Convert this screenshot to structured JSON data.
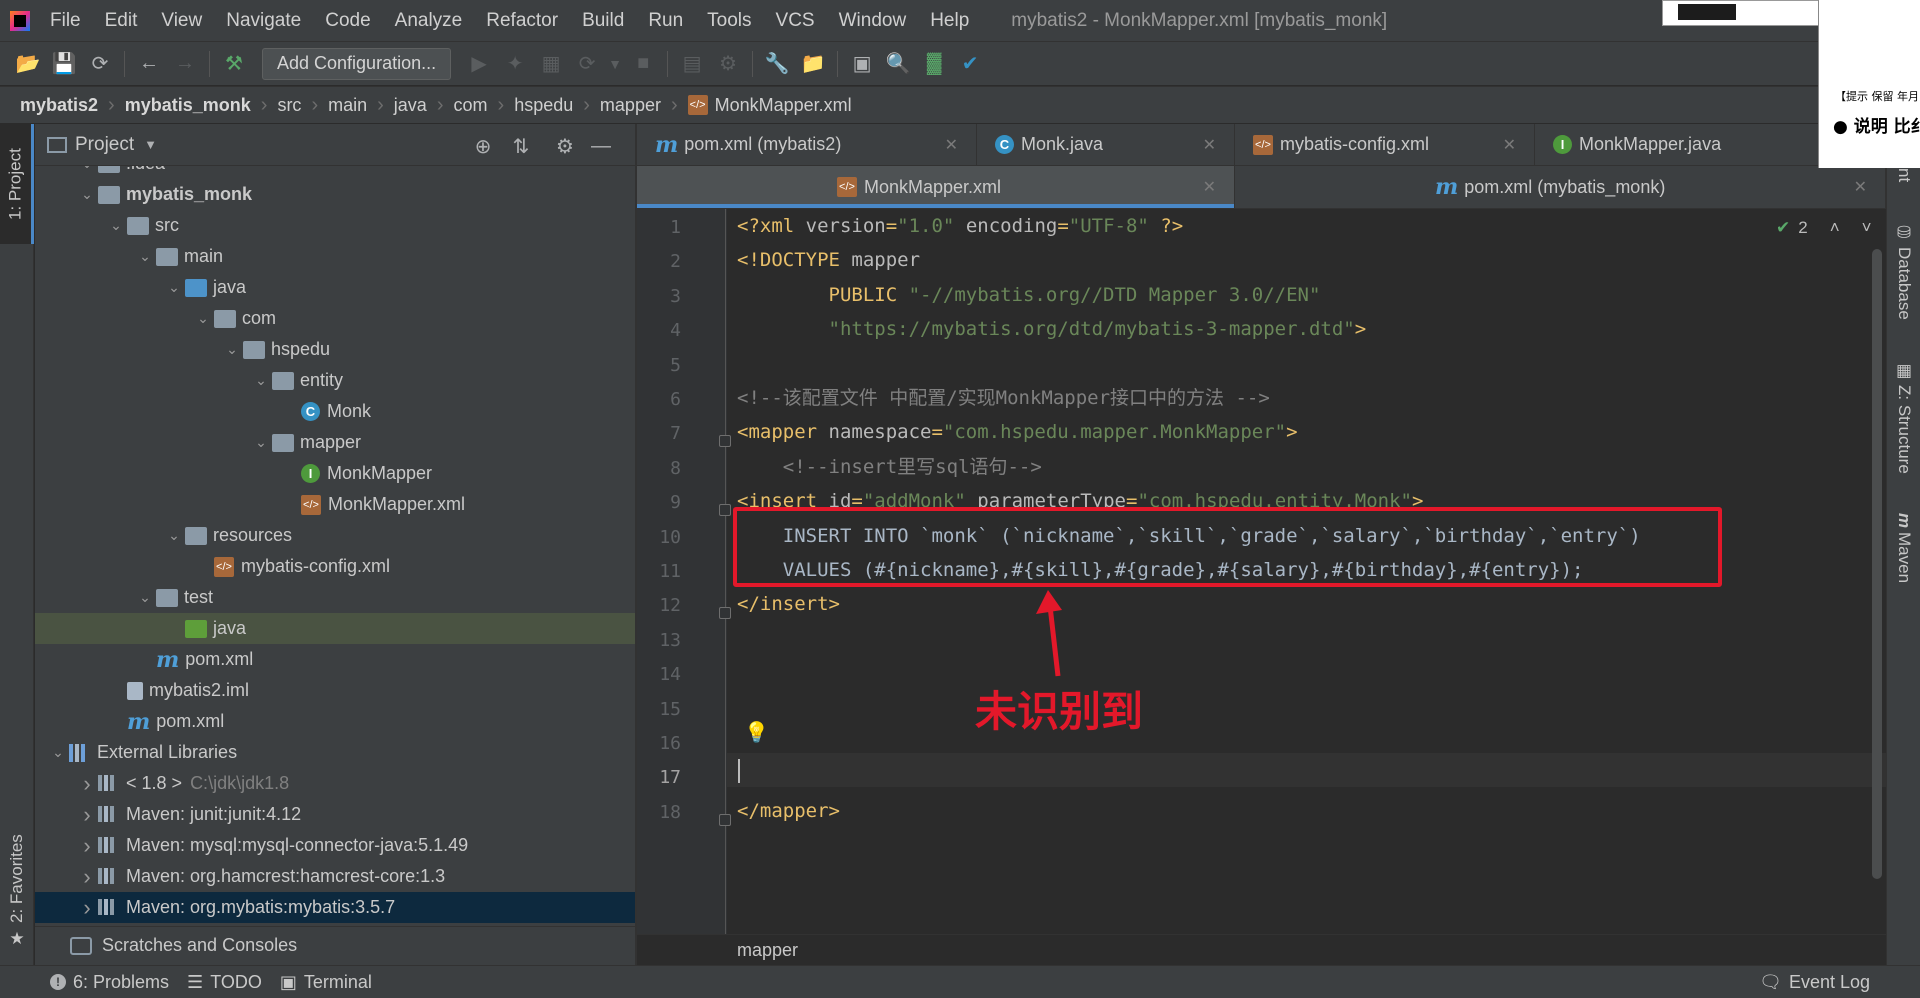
{
  "menubar": {
    "items": [
      "File",
      "Edit",
      "View",
      "Navigate",
      "Code",
      "Analyze",
      "Refactor",
      "Build",
      "Run",
      "Tools",
      "VCS",
      "Window",
      "Help"
    ],
    "window_title": "mybatis2 - MonkMapper.xml [mybatis_monk]"
  },
  "toolbar": {
    "add_configuration": "Add Configuration..."
  },
  "breadcrumbs": [
    "mybatis2",
    "mybatis_monk",
    "src",
    "main",
    "java",
    "com",
    "hspedu",
    "mapper",
    "MonkMapper.xml"
  ],
  "left_strip": {
    "project_tab": "1: Project",
    "favorites_tab": "2: Favorites"
  },
  "right_strip": {
    "database_tab": "Database",
    "structure_tab": "Z: Structure",
    "maven_tab": "Maven",
    "ant_tab": "nt"
  },
  "project": {
    "header": "Project",
    "tree": [
      {
        "label": ".idea",
        "type": "folder"
      },
      {
        "label": "mybatis_monk",
        "type": "module"
      },
      {
        "label": "src",
        "type": "folder"
      },
      {
        "label": "main",
        "type": "folder"
      },
      {
        "label": "java",
        "type": "folder-blue"
      },
      {
        "label": "com",
        "type": "package"
      },
      {
        "label": "hspedu",
        "type": "package"
      },
      {
        "label": "entity",
        "type": "package"
      },
      {
        "label": "Monk",
        "type": "class"
      },
      {
        "label": "mapper",
        "type": "package"
      },
      {
        "label": "MonkMapper",
        "type": "interface"
      },
      {
        "label": "MonkMapper.xml",
        "type": "xml"
      },
      {
        "label": "resources",
        "type": "folder-res"
      },
      {
        "label": "mybatis-config.xml",
        "type": "xml"
      },
      {
        "label": "test",
        "type": "folder"
      },
      {
        "label": "java",
        "type": "folder-green"
      },
      {
        "label": "pom.xml",
        "type": "maven"
      },
      {
        "label": "mybatis2.iml",
        "type": "iml"
      },
      {
        "label": "pom.xml",
        "type": "maven"
      },
      {
        "label": "External Libraries",
        "type": "libs"
      },
      {
        "label": "< 1.8 >",
        "extra": "C:\\jdk\\jdk1.8",
        "type": "jdk"
      },
      {
        "label": "Maven: junit:junit:4.12",
        "type": "lib"
      },
      {
        "label": "Maven: mysql:mysql-connector-java:5.1.49",
        "type": "lib"
      },
      {
        "label": "Maven: org.hamcrest:hamcrest-core:1.3",
        "type": "lib"
      },
      {
        "label": "Maven: org.mybatis:mybatis:3.5.7",
        "type": "lib"
      }
    ],
    "scratches": "Scratches and Consoles"
  },
  "tabs_row1": [
    {
      "label": "pom.xml (mybatis2)",
      "icon": "maven-icon"
    },
    {
      "label": "Monk.java",
      "icon": "class-icon"
    },
    {
      "label": "mybatis-config.xml",
      "icon": "xml-icon"
    },
    {
      "label": "MonkMapper.java",
      "icon": "interface-icon"
    }
  ],
  "tabs_row2": [
    {
      "label": "MonkMapper.xml",
      "icon": "xml-icon",
      "active": true
    },
    {
      "label": "pom.xml (mybatis_monk)",
      "icon": "maven-icon"
    }
  ],
  "editor": {
    "line_numbers": [
      "1",
      "2",
      "3",
      "4",
      "5",
      "6",
      "7",
      "8",
      "9",
      "10",
      "11",
      "12",
      "13",
      "14",
      "15",
      "16",
      "17",
      "18"
    ],
    "lines": [
      {
        "seg": [
          [
            "t-tag",
            "<?xml "
          ],
          [
            "t-attr",
            "version"
          ],
          [
            "t-tag",
            "="
          ],
          [
            "t-val",
            "\"1.0\""
          ],
          [
            "t-tag",
            " "
          ],
          [
            "t-attr",
            "encoding"
          ],
          [
            "t-tag",
            "="
          ],
          [
            "t-val",
            "\"UTF-8\""
          ],
          [
            "t-tag",
            " ?>"
          ]
        ]
      },
      {
        "seg": [
          [
            "t-tag",
            "<!DOCTYPE "
          ],
          [
            "t-attr",
            "mapper"
          ]
        ]
      },
      {
        "seg": [
          [
            "t-tag",
            "        PUBLIC "
          ],
          [
            "t-val",
            "\"-//mybatis.org//DTD Mapper 3.0//EN\""
          ]
        ]
      },
      {
        "seg": [
          [
            "t-val",
            "        \"https://mybatis.org/dtd/mybatis-3-mapper.dtd\""
          ],
          [
            "t-tag",
            ">"
          ]
        ]
      },
      {
        "seg": []
      },
      {
        "seg": [
          [
            "t-com",
            "<!--该配置文件 中配置/实现MonkMapper接口中的方法 -->"
          ]
        ]
      },
      {
        "seg": [
          [
            "t-tag",
            "<mapper "
          ],
          [
            "t-attr",
            "namespace"
          ],
          [
            "t-tag",
            "="
          ],
          [
            "t-val",
            "\"com.hspedu.mapper.MonkMapper\""
          ],
          [
            "t-tag",
            ">"
          ]
        ]
      },
      {
        "seg": [
          [
            "t-com",
            "    <!--insert里写sql语句-->"
          ]
        ]
      },
      {
        "seg": [
          [
            "t-tag",
            "<insert "
          ],
          [
            "t-attr",
            "id"
          ],
          [
            "t-tag",
            "="
          ],
          [
            "t-val",
            "\"addMonk\""
          ],
          [
            "t-tag",
            " "
          ],
          [
            "t-attr",
            "parameterType"
          ],
          [
            "t-tag",
            "="
          ],
          [
            "t-val",
            "\"com.hspedu.entity.Monk\""
          ],
          [
            "t-tag",
            ">"
          ]
        ]
      },
      {
        "seg": [
          [
            "t-sql",
            "    INSERT INTO `monk` (`nickname`,`skill`,`grade`,`salary`,`birthday`,`entry`)"
          ]
        ]
      },
      {
        "seg": [
          [
            "t-sql",
            "    VALUES (#{nickname},#{skill},#{grade},#{salary},#{birthday},#{entry});"
          ]
        ]
      },
      {
        "seg": [
          [
            "t-tag",
            "</insert>"
          ]
        ]
      },
      {
        "seg": []
      },
      {
        "seg": []
      },
      {
        "seg": []
      },
      {
        "seg": []
      },
      {
        "seg": []
      },
      {
        "seg": [
          [
            "t-tag",
            "</mapper>"
          ]
        ]
      }
    ],
    "inspection_count": "2",
    "annotation_text": "未识别到",
    "breadcrumb": "mapper"
  },
  "statusbar": {
    "problems": "6: Problems",
    "todo": "TODO",
    "terminal": "Terminal",
    "event_log": "Event Log"
  },
  "overlay": {
    "line1": "【提示 保留 年月",
    "line2": "● 说明 比纟"
  }
}
